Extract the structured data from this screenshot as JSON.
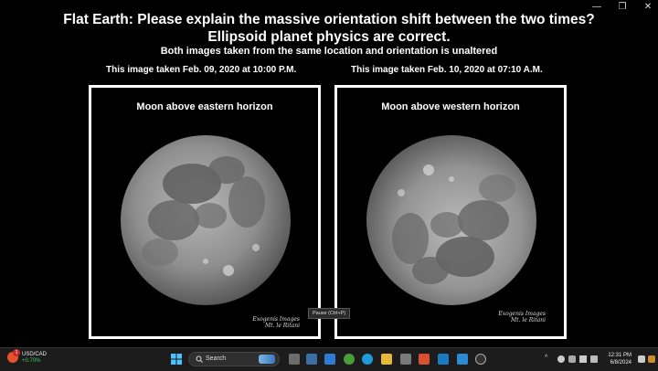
{
  "header": {
    "title_line1": "Flat Earth: Please explain the massive orientation shift between the two times?",
    "title_line2": "Ellipsoid planet physics are correct.",
    "subtitle": "Both images taken from the same location and orientation is unaltered"
  },
  "images": [
    {
      "caption": "This image taken Feb. 09, 2020 at 10:00 P.M.",
      "label": "Moon above eastern horizon",
      "watermark1": "Exogenis Images",
      "watermark2": "Mt. le Ritani"
    },
    {
      "caption": "This image taken Feb. 10, 2020 at 07:10 A.M.",
      "label": "Moon above western horizon",
      "watermark1": "Exogenis Images",
      "watermark2": "Mt. le Ritani"
    }
  ],
  "tooltip": "Pause (Ctrl+P)",
  "taskbar": {
    "ticker_symbol": "USD/CAD",
    "ticker_change": "+0.70%",
    "ticker_badge": "1",
    "search_placeholder": "Search",
    "time": "12:31 PM",
    "date": "6/8/2024",
    "colors": {
      "windows": "#4cc2ff",
      "ticker_up": "#3ecb5e"
    }
  }
}
